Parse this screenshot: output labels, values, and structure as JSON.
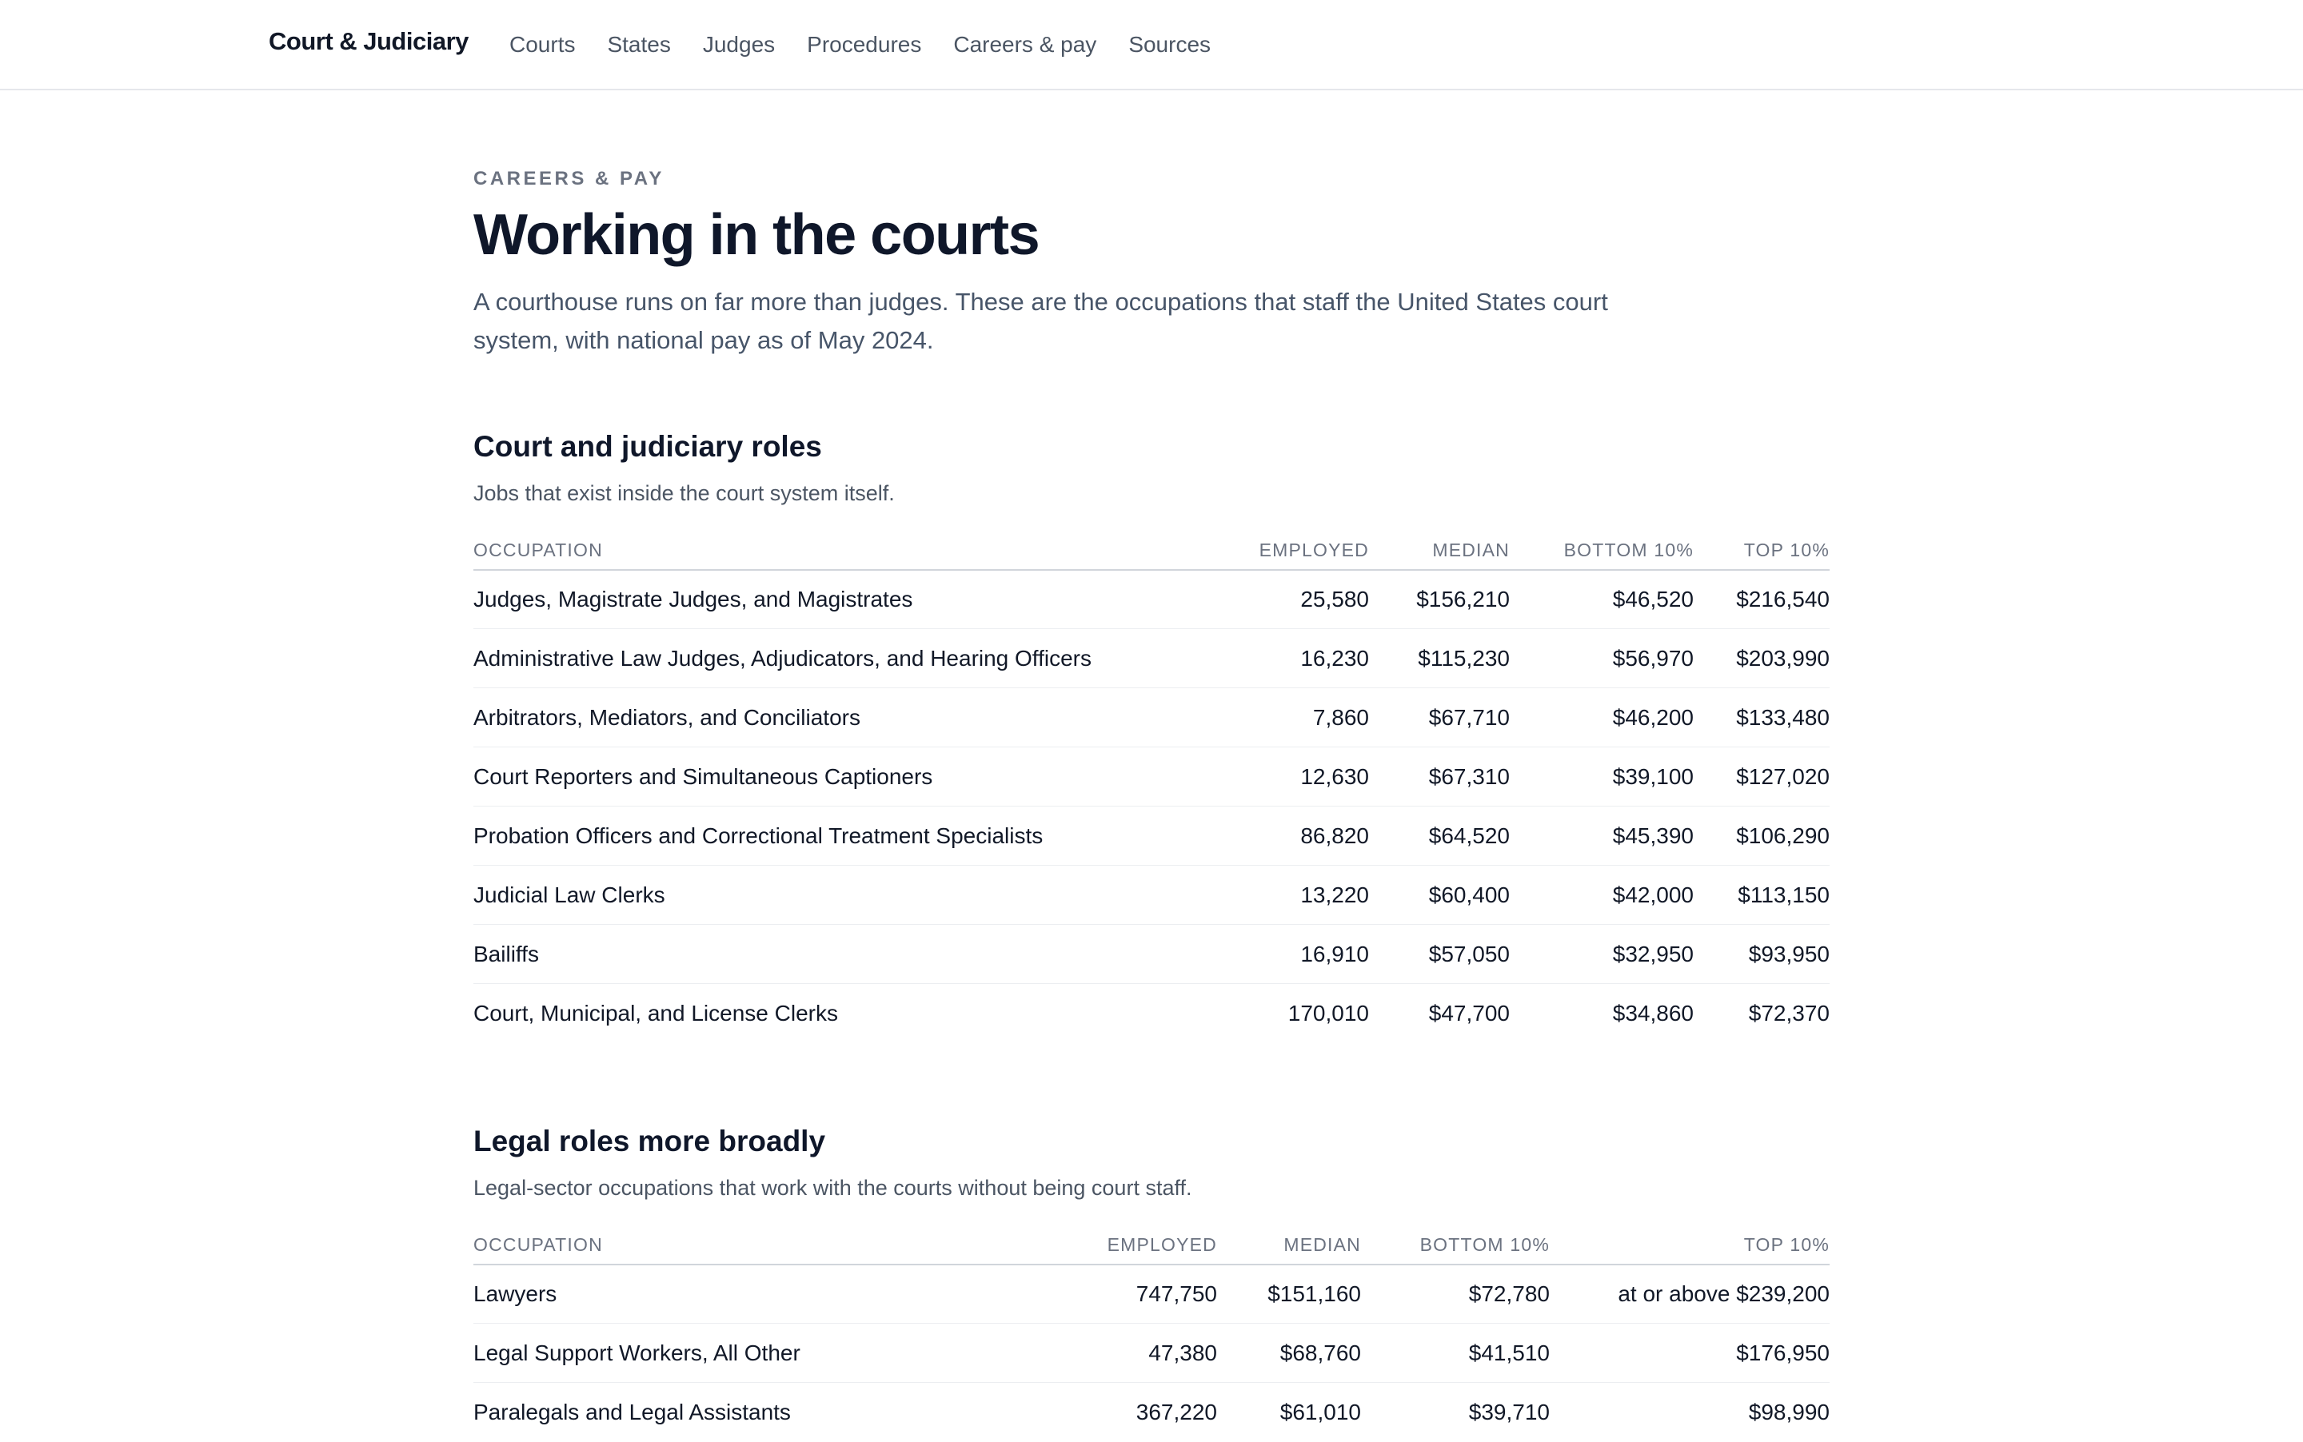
{
  "nav": {
    "brand": "Court & Judiciary",
    "links": [
      "Courts",
      "States",
      "Judges",
      "Procedures",
      "Careers & pay",
      "Sources"
    ]
  },
  "hero": {
    "eyebrow": "CAREERS & PAY",
    "title": "Working in the courts",
    "lede": "A courthouse runs on far more than judges. These are the occupations that staff the United States court system, with national pay as of May 2024."
  },
  "court_roles": {
    "heading": "Court and judiciary roles",
    "subheading": "Jobs that exist inside the court system itself.",
    "columns": [
      "OCCUPATION",
      "EMPLOYED",
      "MEDIAN",
      "BOTTOM 10%",
      "TOP 10%"
    ],
    "rows": [
      [
        "Judges, Magistrate Judges, and Magistrates",
        "25,580",
        "$156,210",
        "$46,520",
        "$216,540"
      ],
      [
        "Administrative Law Judges, Adjudicators, and Hearing Officers",
        "16,230",
        "$115,230",
        "$56,970",
        "$203,990"
      ],
      [
        "Arbitrators, Mediators, and Conciliators",
        "7,860",
        "$67,710",
        "$46,200",
        "$133,480"
      ],
      [
        "Court Reporters and Simultaneous Captioners",
        "12,630",
        "$67,310",
        "$39,100",
        "$127,020"
      ],
      [
        "Probation Officers and Correctional Treatment Specialists",
        "86,820",
        "$64,520",
        "$45,390",
        "$106,290"
      ],
      [
        "Judicial Law Clerks",
        "13,220",
        "$60,400",
        "$42,000",
        "$113,150"
      ],
      [
        "Bailiffs",
        "16,910",
        "$57,050",
        "$32,950",
        "$93,950"
      ],
      [
        "Court, Municipal, and License Clerks",
        "170,010",
        "$47,700",
        "$34,860",
        "$72,370"
      ]
    ]
  },
  "legal_roles": {
    "heading": "Legal roles more broadly",
    "subheading": "Legal-sector occupations that work with the courts without being court staff.",
    "columns": [
      "OCCUPATION",
      "EMPLOYED",
      "MEDIAN",
      "BOTTOM 10%",
      "TOP 10%"
    ],
    "rows": [
      [
        "Lawyers",
        "747,750",
        "$151,160",
        "$72,780",
        "at or above $239,200"
      ],
      [
        "Legal Support Workers, All Other",
        "47,380",
        "$68,760",
        "$41,510",
        "$176,950"
      ],
      [
        "Paralegals and Legal Assistants",
        "367,220",
        "$61,010",
        "$39,710",
        "$98,990"
      ]
    ]
  }
}
